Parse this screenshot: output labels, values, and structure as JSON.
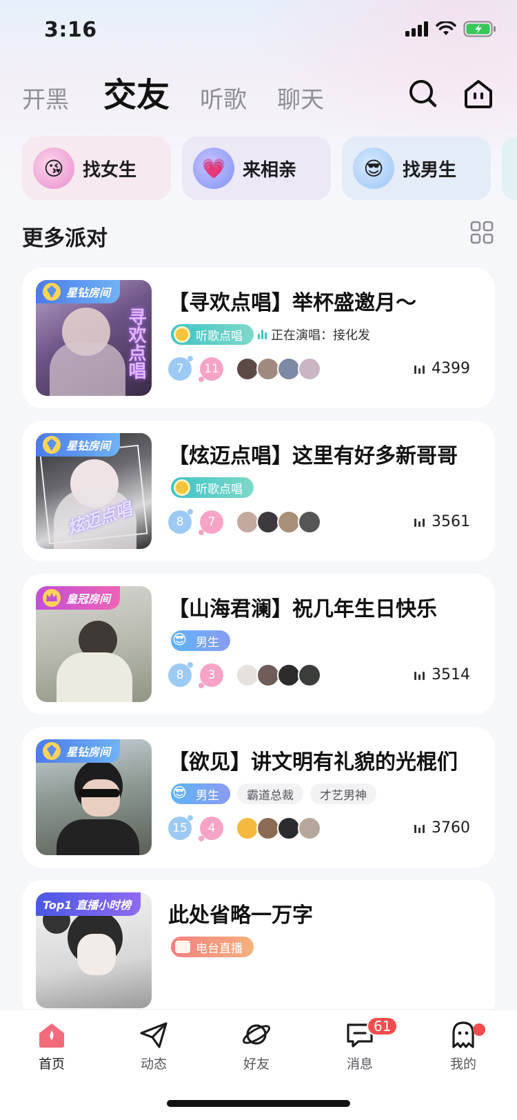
{
  "status_bar": {
    "time": "3:16"
  },
  "top_tabs": [
    {
      "label": "开黑",
      "active": false
    },
    {
      "label": "交友",
      "active": true
    },
    {
      "label": "听歌",
      "active": false
    },
    {
      "label": "聊天",
      "active": false
    }
  ],
  "header_icons": [
    "search-icon",
    "home-icon"
  ],
  "quick_chips": [
    {
      "label": "找女生",
      "icon": "heart-face-icon"
    },
    {
      "label": "来相亲",
      "icon": "heart-icon"
    },
    {
      "label": "找男生",
      "icon": "sunglasses-face-icon"
    }
  ],
  "section": {
    "title": "更多派对"
  },
  "rooms": [
    {
      "badge": "星钻房间",
      "title": "【寻欢点唱】举杯盛邀月～",
      "tag": "听歌点唱",
      "now_singing_label": "正在演唱：",
      "now_singing": "接化发",
      "male_count": "7",
      "female_count": "11",
      "listeners": "4399"
    },
    {
      "badge": "星钻房间",
      "title": "【炫迈点唱】这里有好多新哥哥",
      "tag": "听歌点唱",
      "male_count": "8",
      "female_count": "7",
      "listeners": "3561"
    },
    {
      "badge": "皇冠房间",
      "title": "【山海君澜】祝几年生日快乐",
      "tag": "男生",
      "male_count": "8",
      "female_count": "3",
      "listeners": "3514"
    },
    {
      "badge": "星钻房间",
      "title": "【欲见】讲文明有礼貌的光棍们",
      "tag": "男生",
      "extra_tags": [
        "霸道总裁",
        "才艺男神"
      ],
      "male_count": "15",
      "female_count": "4",
      "listeners": "3760"
    },
    {
      "badge": "Top1 直播小时榜",
      "title": "此处省略一万字",
      "tag": "电台直播"
    }
  ],
  "bottom_nav": [
    {
      "label": "首页",
      "icon": "home-flame-icon",
      "active": true
    },
    {
      "label": "动态",
      "icon": "paper-plane-icon"
    },
    {
      "label": "好友",
      "icon": "planet-icon"
    },
    {
      "label": "消息",
      "icon": "message-icon",
      "badge": "61"
    },
    {
      "label": "我的",
      "icon": "ghost-icon"
    }
  ],
  "colors": {
    "accent_pink": "#f24d4d",
    "song_tag": "#3ec4c7",
    "male": "#9ccaf4",
    "female": "#f6a4c6"
  }
}
